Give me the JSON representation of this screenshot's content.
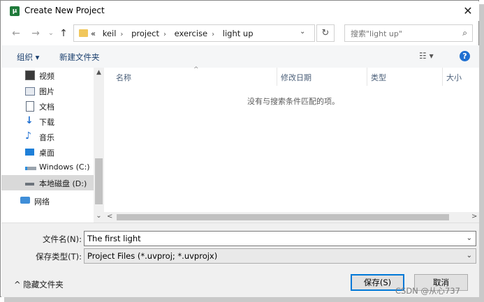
{
  "window": {
    "title": "Create New Project",
    "close_glyph": "✕",
    "app_icon_text": "µ"
  },
  "nav_buttons": {
    "back": "←",
    "forward": "→",
    "recent": "⌄",
    "up": "↑"
  },
  "address": {
    "prefix": "«",
    "crumbs": [
      "keil",
      "project",
      "exercise",
      "light up"
    ],
    "separator": "›",
    "dropdown": "⌄"
  },
  "refresh_glyph": "↻",
  "search": {
    "placeholder": "搜索\"light up\"",
    "icon": "⌕"
  },
  "toolbar": {
    "organize": "组织 ▾",
    "new_folder": "新建文件夹",
    "view_glyph": "☷ ▾",
    "help_glyph": "?"
  },
  "nav_pane": {
    "items": [
      {
        "label": "视频",
        "icon": "video-icon"
      },
      {
        "label": "图片",
        "icon": "pictures-icon"
      },
      {
        "label": "文档",
        "icon": "documents-icon"
      },
      {
        "label": "下载",
        "icon": "download-icon"
      },
      {
        "label": "音乐",
        "icon": "music-icon"
      },
      {
        "label": "桌面",
        "icon": "desktop-icon"
      },
      {
        "label": "Windows (C:)",
        "icon": "drive-c-icon"
      },
      {
        "label": "本地磁盘 (D:)",
        "icon": "drive-d-icon",
        "selected": true
      },
      {
        "label": "网络",
        "icon": "network-icon"
      }
    ],
    "scroll_up": "▲",
    "scroll_down": "⌄"
  },
  "file_list": {
    "columns": [
      "名称",
      "修改日期",
      "类型",
      "大小"
    ],
    "sort_caret": "^",
    "empty_message": "没有与搜索条件匹配的项。",
    "scroll_left": "<",
    "scroll_right": ">"
  },
  "form": {
    "filename_label": "文件名(N):",
    "filename_value": "The first light",
    "type_label": "保存类型(T):",
    "type_value": "Project Files (*.uvproj; *.uvprojx)",
    "dropdown_glyph": "⌄"
  },
  "footer": {
    "hide_folders": "^ 隐藏文件夹",
    "save": "保存(S)",
    "cancel": "取消"
  },
  "watermark": "CSDN @从心737",
  "colors": {
    "accent": "#0078d7",
    "help": "#1f6fd1",
    "folder": "#f1c75c",
    "selection": "#d9d9d9"
  }
}
